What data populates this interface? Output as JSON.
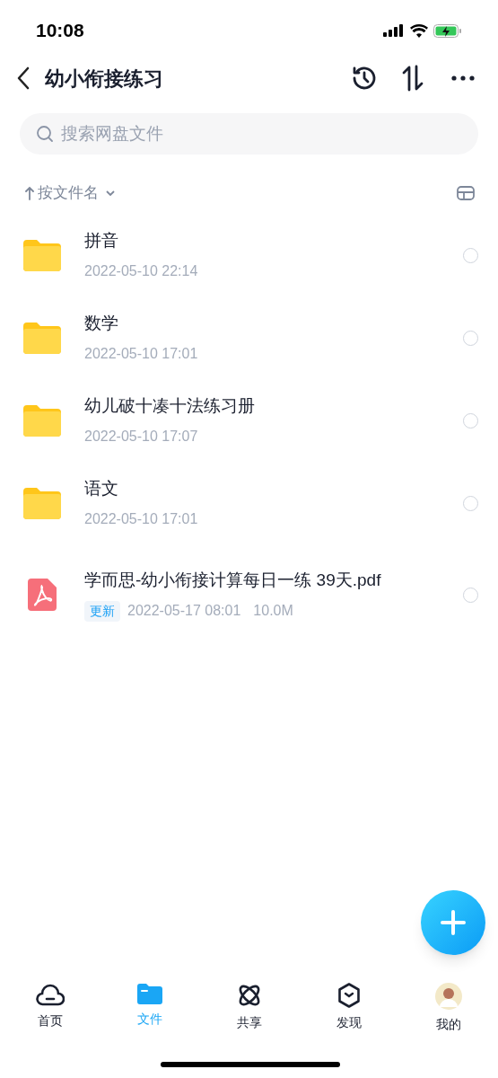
{
  "status_bar": {
    "time": "10:08"
  },
  "header": {
    "title": "幼小衔接练习"
  },
  "search": {
    "placeholder": "搜索网盘文件"
  },
  "sort": {
    "label": "按文件名"
  },
  "files": [
    {
      "kind": "folder",
      "name": "拼音",
      "date": "2022-05-10 22:14",
      "selected": false
    },
    {
      "kind": "folder",
      "name": "数学",
      "date": "2022-05-10 17:01",
      "selected": false
    },
    {
      "kind": "folder",
      "name": "幼儿破十凑十法练习册",
      "date": "2022-05-10 17:07",
      "selected": false
    },
    {
      "kind": "folder",
      "name": "语文",
      "date": "2022-05-10 17:01",
      "selected": false
    },
    {
      "kind": "pdf",
      "name": "学而思-幼小衔接计算每日一练 39天.pdf",
      "badge": "更新",
      "date": "2022-05-17 08:01",
      "size": "10.0M",
      "selected": false
    }
  ],
  "tabs": [
    {
      "kind": "home",
      "label": "首页",
      "selected": false
    },
    {
      "kind": "files",
      "label": "文件",
      "selected": true
    },
    {
      "kind": "share",
      "label": "共享",
      "selected": false
    },
    {
      "kind": "discover",
      "label": "发现",
      "selected": false
    },
    {
      "kind": "me",
      "label": "我的",
      "selected": false
    }
  ]
}
